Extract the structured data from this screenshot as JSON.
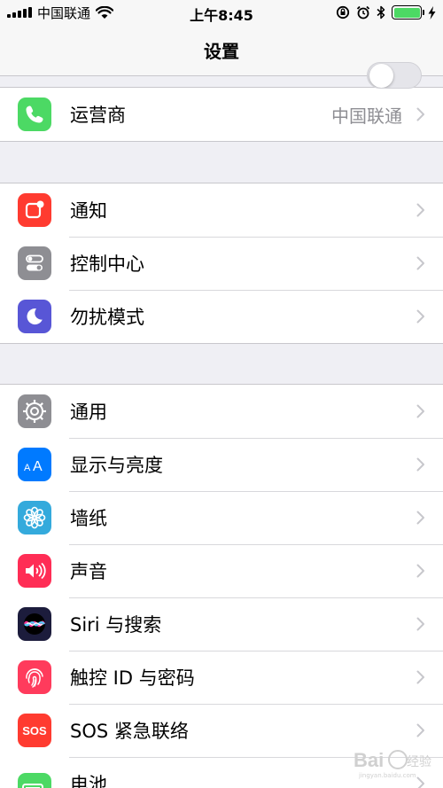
{
  "status_bar": {
    "carrier": "中国联通",
    "time": "上午8:45",
    "battery_level": 1.0
  },
  "nav": {
    "title": "设置"
  },
  "groups": [
    {
      "items": [
        {
          "label": "运营商",
          "value": "中国联通",
          "icon": "phone-icon",
          "color": "#4cd964"
        }
      ]
    },
    {
      "items": [
        {
          "label": "通知",
          "icon": "notifications-icon",
          "color": "#ff3b30"
        },
        {
          "label": "控制中心",
          "icon": "control-center-icon",
          "color": "#8e8e93"
        },
        {
          "label": "勿扰模式",
          "icon": "moon-icon",
          "color": "#5856d6"
        }
      ]
    },
    {
      "items": [
        {
          "label": "通用",
          "icon": "gear-icon",
          "color": "#8e8e93"
        },
        {
          "label": "显示与亮度",
          "icon": "display-aa-icon",
          "color": "#007aff"
        },
        {
          "label": "墙纸",
          "icon": "wallpaper-flower-icon",
          "color": "#34aadc"
        },
        {
          "label": "声音",
          "icon": "speaker-icon",
          "color": "#ff2d55"
        },
        {
          "label": "Siri 与搜索",
          "icon": "siri-icon",
          "color": "#1c1c3c"
        },
        {
          "label": "触控 ID 与密码",
          "icon": "fingerprint-icon",
          "color": "#ff3b5c"
        },
        {
          "label": "SOS 紧急联络",
          "icon": "sos-icon",
          "color": "#ff3b30",
          "icon_text": "SOS"
        },
        {
          "label": "电池",
          "icon": "battery-icon",
          "color": "#4cd964"
        }
      ]
    }
  ],
  "watermark": {
    "text": "Bai",
    "text2": "经验",
    "sub": "jingyan.baidu.com"
  }
}
